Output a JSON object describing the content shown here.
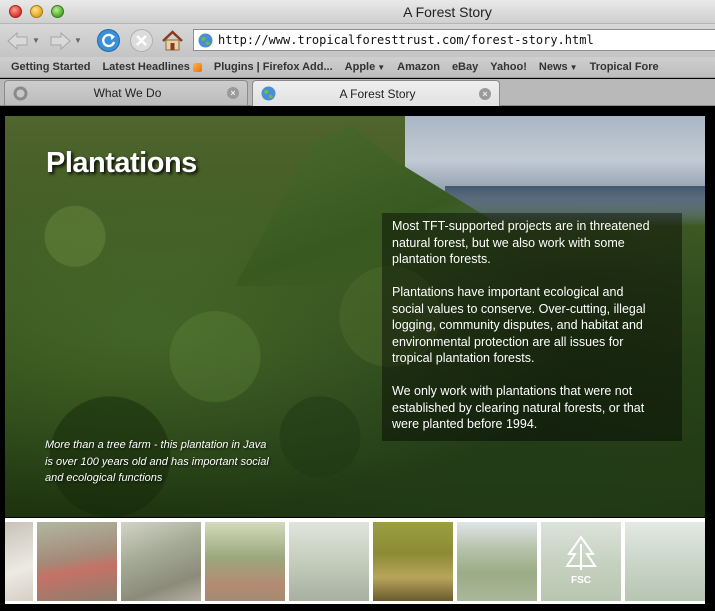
{
  "window": {
    "title": "A Forest Story"
  },
  "toolbar": {
    "url": "http://www.tropicalforesttrust.com/forest-story.html",
    "icons": [
      "back-icon",
      "forward-icon",
      "reload-icon",
      "stop-icon",
      "home-icon",
      "globe-icon"
    ]
  },
  "bookmarks": [
    {
      "label": "Getting Started"
    },
    {
      "label": "Latest Headlines"
    },
    {
      "label": "Plugins | Firefox Add..."
    },
    {
      "label": "Apple"
    },
    {
      "label": "Amazon"
    },
    {
      "label": "eBay"
    },
    {
      "label": "Yahoo!"
    },
    {
      "label": "News"
    },
    {
      "label": "Tropical Fore"
    }
  ],
  "tabs": [
    {
      "label": "What We Do",
      "active": false
    },
    {
      "label": "A Forest Story",
      "active": true
    }
  ],
  "page": {
    "title": "Plantations",
    "paragraphs": [
      "Most TFT-supported projects are in threatened natural forest, but we also work with some plantation forests.",
      "Plantations have important ecological and social values to conserve. Over-cutting, illegal logging, community disputes, and habitat and environmental protection are all issues for tropical plantation forests.",
      "We only work with plantations that were not established by clearing natural forests, or that were planted before 1994."
    ],
    "caption": "More than a tree farm - this plantation in Java is over 100 years old and has important social and ecological functions",
    "thumbnail_logo_text": "FSC"
  }
}
